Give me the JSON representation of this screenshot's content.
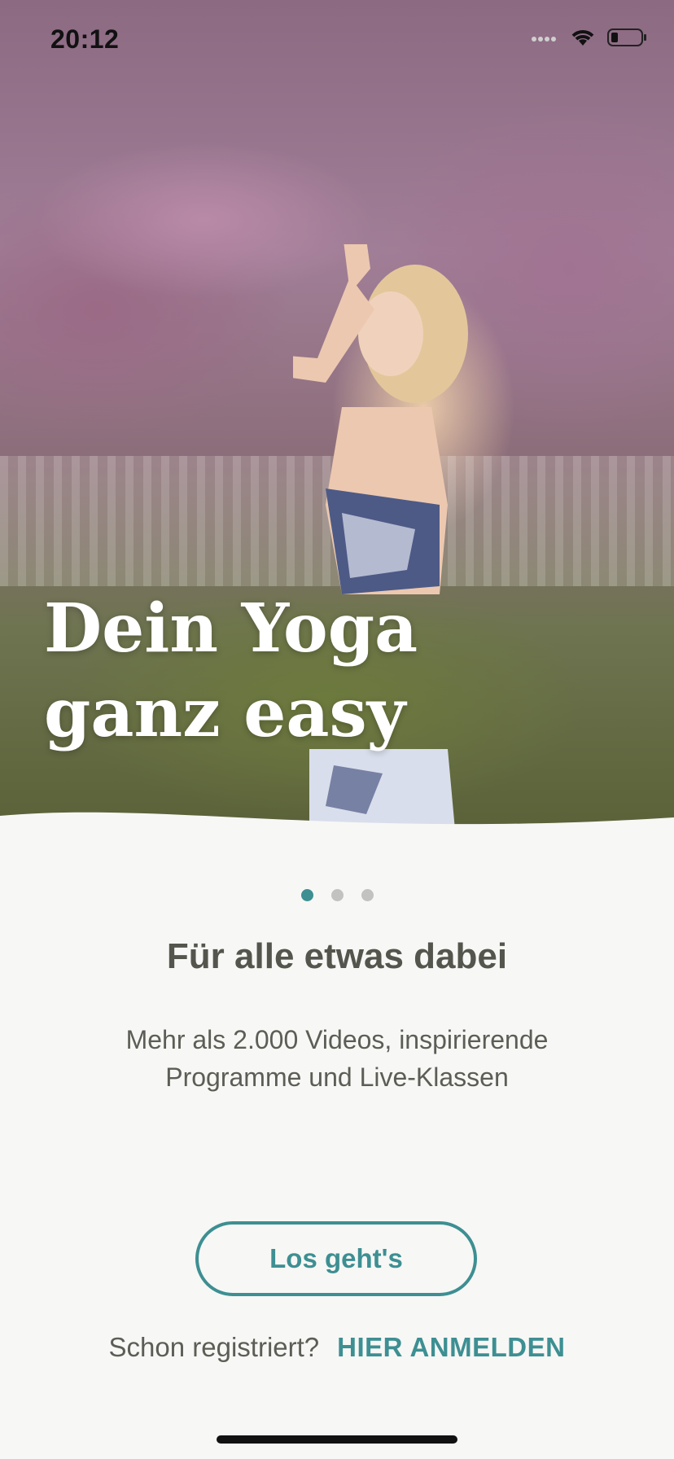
{
  "status_bar": {
    "time": "20:12",
    "icons": [
      "signal-dots-icon",
      "wifi-icon",
      "battery-icon"
    ]
  },
  "hero": {
    "title": "Dein Yoga\nganz easy",
    "image": "woman-yoga-pose-blossoms"
  },
  "carousel": {
    "pages": 3,
    "active_index": 0
  },
  "content": {
    "headline": "Für alle etwas dabei",
    "subtext": "Mehr als 2.000 Videos, inspirierende Programme und Live-Klassen"
  },
  "actions": {
    "primary_label": "Los geht's",
    "login_question": "Schon registriert?",
    "login_link": "HIER ANMELDEN"
  },
  "colors": {
    "accent": "#3d8f92",
    "text": "#54554d",
    "background": "#f7f7f5"
  }
}
